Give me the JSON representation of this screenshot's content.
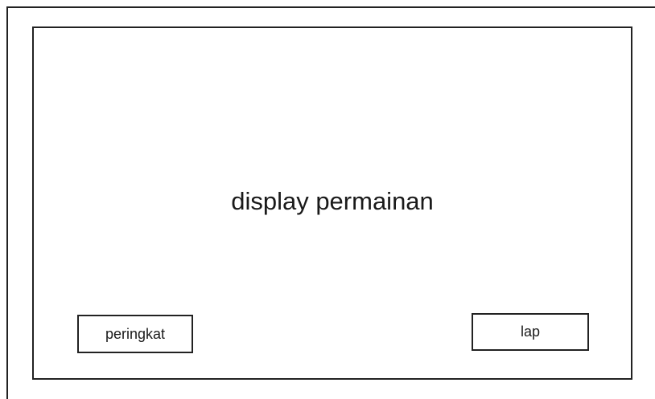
{
  "main": {
    "display_label": "display permainan"
  },
  "buttons": {
    "peringkat_label": "peringkat",
    "lap_label": "lap"
  }
}
